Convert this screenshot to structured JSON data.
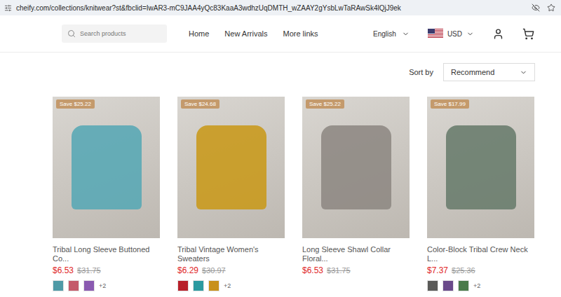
{
  "browser": {
    "url": "cheify.com/collections/knitwear?st&fbclid=IwAR3-mC9JAA4yQc83KaaA3wdhzUqDMTH_wZAAY2gYsbLwTaRAwSk4lQjJ9ek"
  },
  "header": {
    "search_placeholder": "Search products",
    "nav": [
      "Home",
      "New Arrivals",
      "More links"
    ],
    "language": "English",
    "currency": "USD"
  },
  "sort": {
    "label": "Sort by",
    "value": "Recommend"
  },
  "products": [
    {
      "badge": "Save $25.22",
      "title": "Tribal Long Sleeve Buttoned Co...",
      "price": "$6.53",
      "old_price": "$31.75",
      "color": "#5aa8b5",
      "swatches": [
        {
          "color": "#4f9aa6"
        },
        {
          "color": "#c45a6a"
        },
        {
          "color": "#8a5ab0"
        }
      ],
      "more": "+2"
    },
    {
      "badge": "Save $24.68",
      "title": "Tribal Vintage Women's Sweaters",
      "price": "$6.29",
      "old_price": "$30.97",
      "color": "#c99a1e",
      "swatches": [
        {
          "color": "#b8202a"
        },
        {
          "color": "#2a9aa0"
        },
        {
          "color": "#c8901a"
        }
      ],
      "more": "+2"
    },
    {
      "badge": "Save $25.22",
      "title": "Long Sleeve Shawl Collar Floral...",
      "price": "$6.53",
      "old_price": "$31.75",
      "color": "#8f8a84",
      "swatches": [],
      "more": ""
    },
    {
      "badge": "Save $17.99",
      "title": "Color-Block Tribal Crew Neck L...",
      "price": "$7.37",
      "old_price": "$25.36",
      "color": "#6a7d6e",
      "swatches": [
        {
          "color": "#5a5a58"
        },
        {
          "color": "#6a4a8a"
        },
        {
          "color": "#4a7a4a"
        }
      ],
      "more": "+2"
    }
  ]
}
